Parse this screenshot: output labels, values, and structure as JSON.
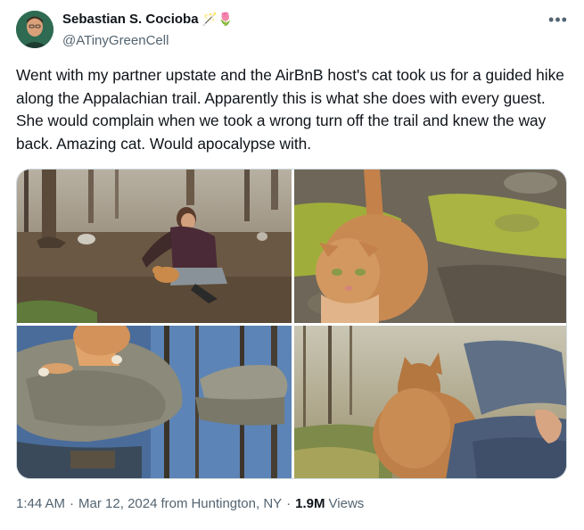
{
  "author": {
    "display_name": "Sebastian S. Cocioba",
    "name_emojis": "🪄🌷",
    "handle": "@ATinyGreenCell",
    "avatar_icon": "profile-avatar"
  },
  "tweet": {
    "text": "Went with my partner upstate and the AirBnB host's cat took us for a guided hike along the Appalachian trail. Apparently this is what she does with every guest. She would complain when we took a wrong turn off the trail and knew the way back. Amazing cat. Would apocalypse with.",
    "more_icon": "•••"
  },
  "media": {
    "photo_count": 4,
    "photos": [
      {
        "subject": "person-with-cat-forest"
      },
      {
        "subject": "orange-cat-on-moss"
      },
      {
        "subject": "cat-on-rock-by-water"
      },
      {
        "subject": "cat-sitting-on-lap"
      }
    ]
  },
  "meta": {
    "time": "1:44 AM",
    "separator": "·",
    "date": "Mar 12, 2024",
    "from_label": "from",
    "location": "Huntington, NY",
    "views_count": "1.9M",
    "views_label": "Views"
  },
  "colors": {
    "text": "#0f1419",
    "secondary": "#536471",
    "border": "#cfd9de"
  }
}
